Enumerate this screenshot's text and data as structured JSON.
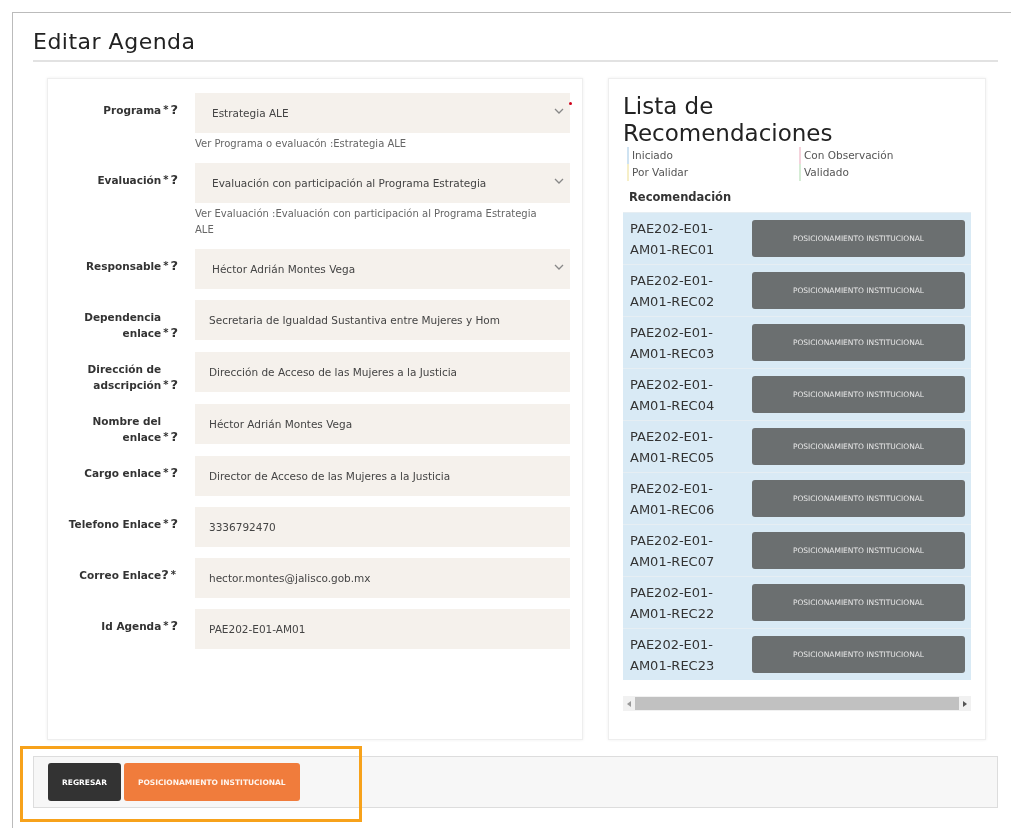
{
  "page": {
    "title": "Editar Agenda"
  },
  "form": {
    "fields": [
      {
        "label": "Programa",
        "marks": [
          {
            "kind": "required",
            "text": "*"
          },
          {
            "kind": "help",
            "text": "?"
          }
        ],
        "kind": "select",
        "value": "Estrategia ALE",
        "flagged": true,
        "note": "Ver Programa o evaluacón :Estrategia ALE"
      },
      {
        "label": "Evaluación",
        "marks": [
          {
            "kind": "required",
            "text": "*"
          },
          {
            "kind": "help",
            "text": "?"
          }
        ],
        "kind": "select",
        "value": "Evaluación con participación al Programa Estrategia",
        "flagged": false,
        "note": "Ver Evaluación :Evaluación con participación al Programa Estrategia ALE"
      },
      {
        "label": "Responsable",
        "marks": [
          {
            "kind": "required",
            "text": "*"
          },
          {
            "kind": "help",
            "text": "?"
          }
        ],
        "kind": "select",
        "value": "Héctor Adrián Montes Vega",
        "flagged": false
      },
      {
        "label": "Dependencia enlace",
        "marks": [
          {
            "kind": "required",
            "text": "*"
          },
          {
            "kind": "help",
            "text": "?"
          }
        ],
        "kind": "input",
        "value": "Secretaria de Igualdad Sustantiva entre Mujeres y Hom"
      },
      {
        "label": "Dirección de adscripción",
        "marks": [
          {
            "kind": "required",
            "text": "*"
          },
          {
            "kind": "help",
            "text": "?"
          }
        ],
        "kind": "input",
        "value": "Dirección de Acceso de las Mujeres a la Justicia"
      },
      {
        "label": "Nombre del enlace",
        "marks": [
          {
            "kind": "required",
            "text": "*"
          },
          {
            "kind": "help",
            "text": "?"
          }
        ],
        "kind": "input",
        "value": "Héctor Adrián Montes Vega"
      },
      {
        "label": "Cargo enlace",
        "marks": [
          {
            "kind": "required",
            "text": "*"
          },
          {
            "kind": "help",
            "text": "?"
          }
        ],
        "kind": "input",
        "value": "Director de Acceso de las Mujeres a la Justicia"
      },
      {
        "label": "Telefono Enlace",
        "marks": [
          {
            "kind": "required",
            "text": "*"
          },
          {
            "kind": "help",
            "text": "?"
          }
        ],
        "kind": "input",
        "value": "3336792470"
      },
      {
        "label": "Correo Enlace",
        "marks": [
          {
            "kind": "help",
            "text": "?"
          },
          {
            "kind": "required",
            "text": "*"
          }
        ],
        "kind": "input",
        "value": "hector.montes@jalisco.gob.mx"
      },
      {
        "label": "Id Agenda",
        "marks": [
          {
            "kind": "required",
            "text": "*"
          },
          {
            "kind": "help",
            "text": "?"
          }
        ],
        "kind": "input",
        "value": "PAE202-E01-AM01"
      }
    ]
  },
  "recommendations": {
    "title": "Lista de Recomendaciones",
    "legend": [
      {
        "label": "Iniciado",
        "color": "#cfe3f2"
      },
      {
        "label": "Con Observación",
        "color": "#f4d3dc"
      },
      {
        "label": "Por Validar",
        "color": "#f6efc8"
      },
      {
        "label": "Validado",
        "color": "#d5ecd5"
      }
    ],
    "column": "Recomendación",
    "rows": [
      {
        "code": "PAE202-E01-AM01-REC01",
        "action": "POSICIONAMIENTO INSTITUCIONAL",
        "color": "#d9eaf5"
      },
      {
        "code": "PAE202-E01-AM01-REC02",
        "action": "POSICIONAMIENTO INSTITUCIONAL",
        "color": "#d9eaf5"
      },
      {
        "code": "PAE202-E01-AM01-REC03",
        "action": "POSICIONAMIENTO INSTITUCIONAL",
        "color": "#d9eaf5"
      },
      {
        "code": "PAE202-E01-AM01-REC04",
        "action": "POSICIONAMIENTO INSTITUCIONAL",
        "color": "#d9eaf5"
      },
      {
        "code": "PAE202-E01-AM01-REC05",
        "action": "POSICIONAMIENTO INSTITUCIONAL",
        "color": "#d9eaf5"
      },
      {
        "code": "PAE202-E01-AM01-REC06",
        "action": "POSICIONAMIENTO INSTITUCIONAL",
        "color": "#d9eaf5"
      },
      {
        "code": "PAE202-E01-AM01-REC07",
        "action": "POSICIONAMIENTO INSTITUCIONAL",
        "color": "#d9eaf5"
      },
      {
        "code": "PAE202-E01-AM01-REC22",
        "action": "POSICIONAMIENTO INSTITUCIONAL",
        "color": "#d9eaf5"
      },
      {
        "code": "PAE202-E01-AM01-REC23",
        "action": "POSICIONAMIENTO INSTITUCIONAL",
        "color": "#d9eaf5"
      }
    ]
  },
  "actions": {
    "buttons": [
      {
        "label": "REGRESAR",
        "kind": "back"
      },
      {
        "label": "POSICIONAMIENTO INSTITUCIONAL",
        "kind": "primary"
      }
    ],
    "highlighted": true
  }
}
